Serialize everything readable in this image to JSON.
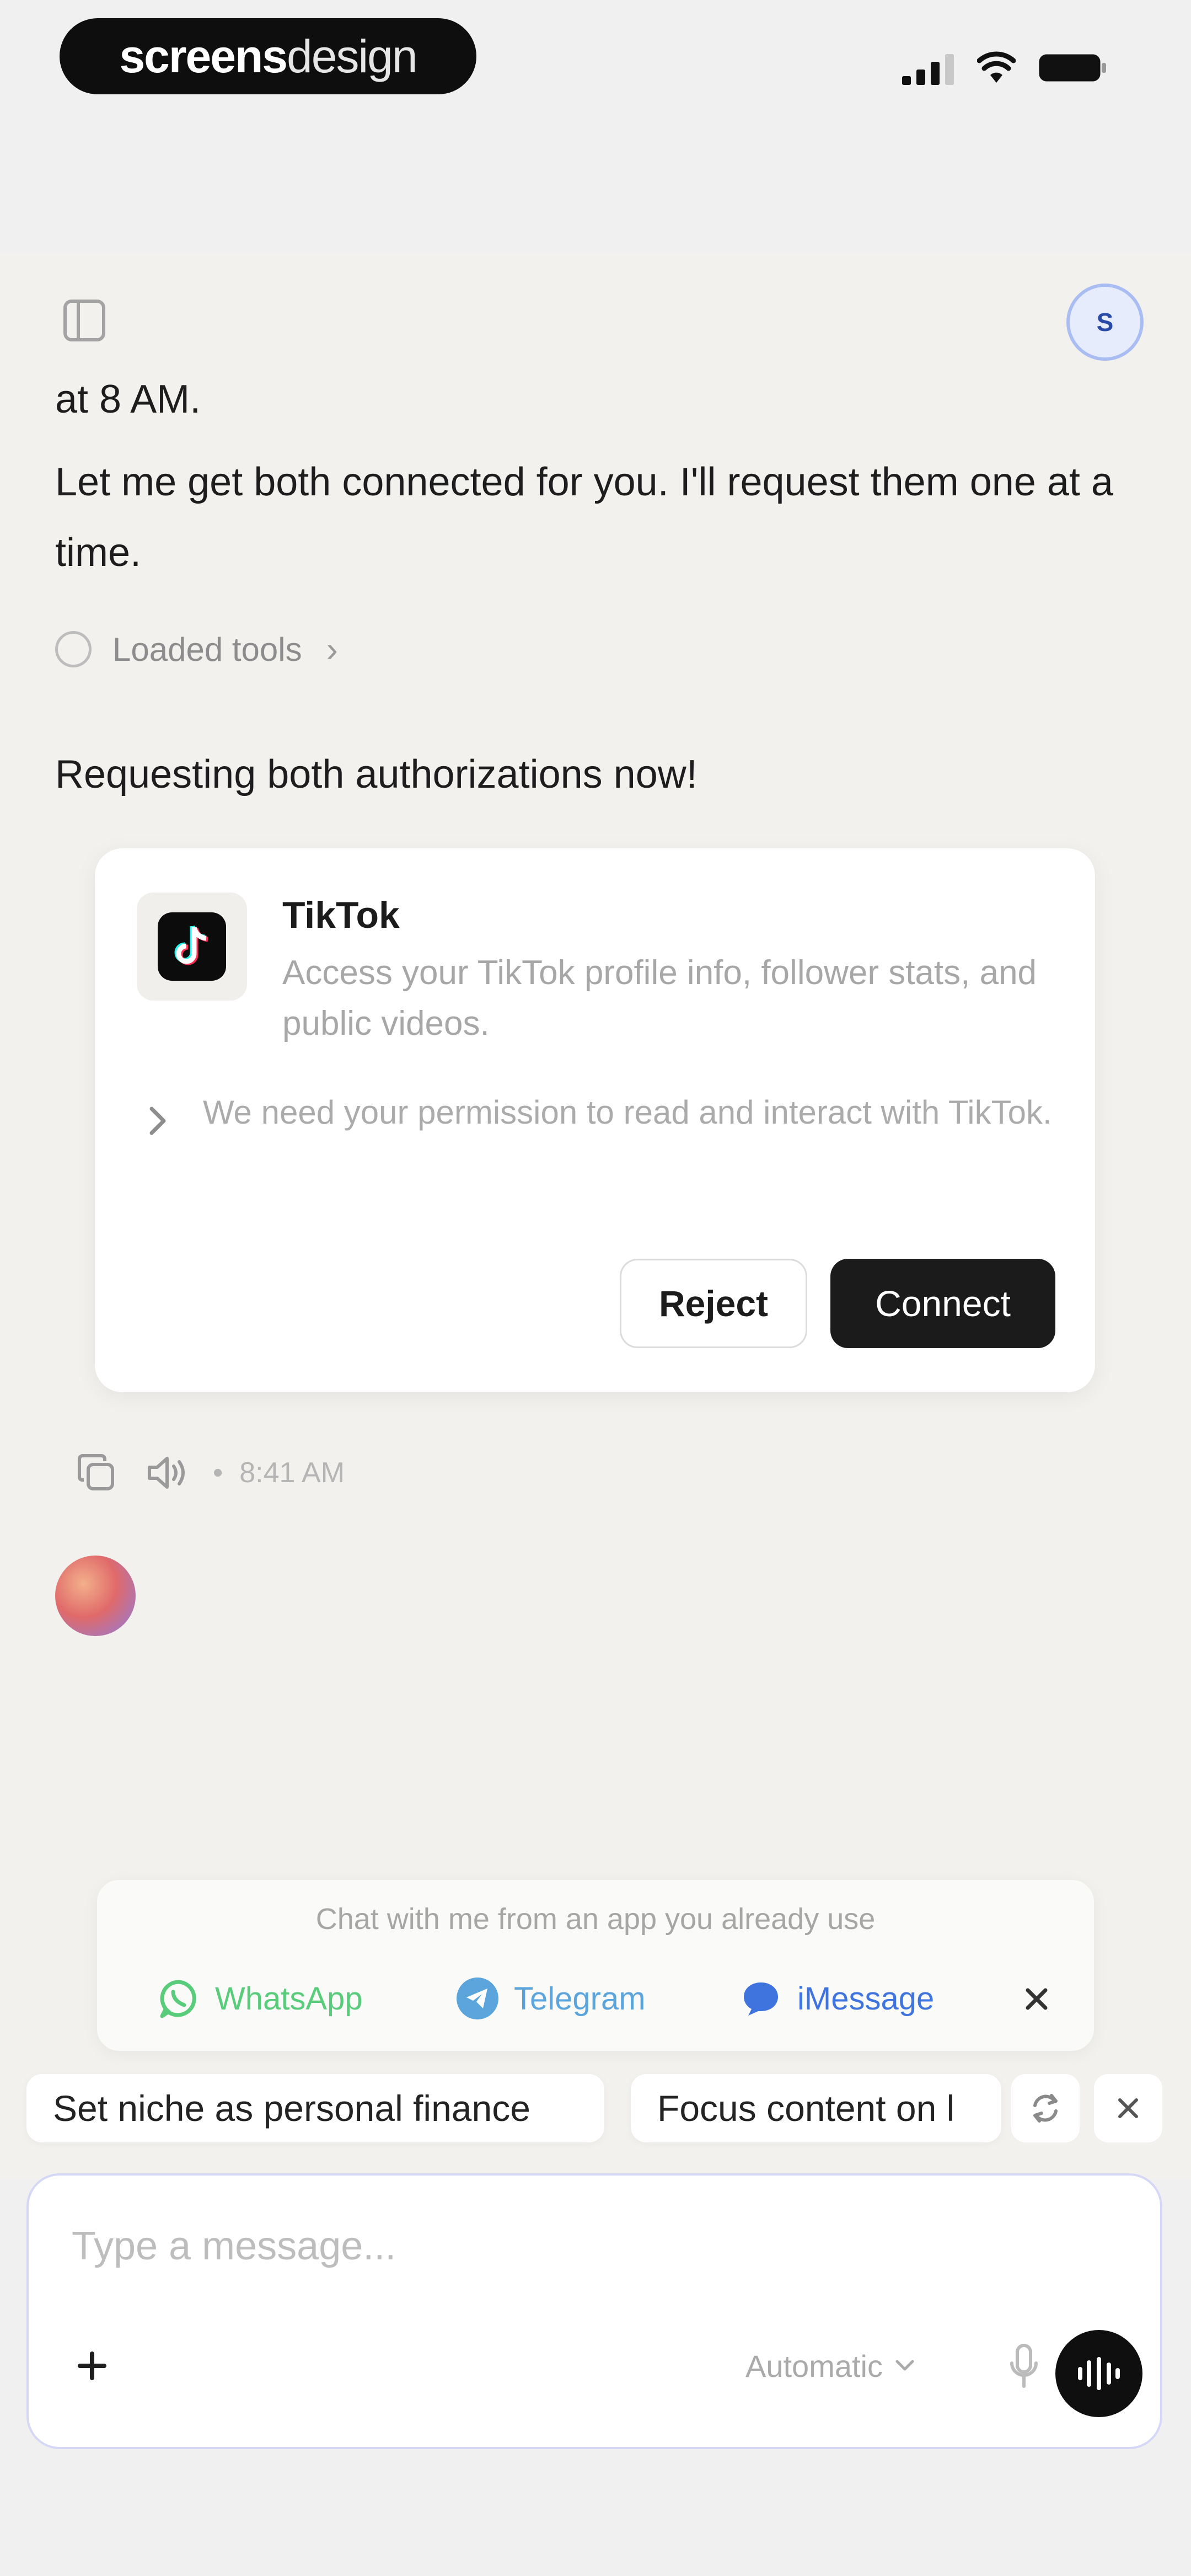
{
  "brand": {
    "part1": "screens",
    "part2": "design"
  },
  "chat": {
    "avatar_initial": "S",
    "line1": "at 8 AM.",
    "line2": "Let me get both connected for you. I'll request them one at a time.",
    "tools_label": "Loaded tools",
    "line3": "Requesting both authorizations now!"
  },
  "auth_card": {
    "title": "TikTok",
    "description": "Access your TikTok profile info, follower stats, and public videos.",
    "permission": "We need your permission to read and interact with TikTok.",
    "reject_label": "Reject",
    "connect_label": "Connect"
  },
  "message_meta": {
    "time": "8:41 AM"
  },
  "channels": {
    "prompt": "Chat with me from an app you already use",
    "items": [
      {
        "label": "WhatsApp",
        "icon": "whatsapp-icon",
        "color": "#58cc7a"
      },
      {
        "label": "Telegram",
        "icon": "telegram-icon",
        "color": "#5ba5dc"
      },
      {
        "label": "iMessage",
        "icon": "imessage-icon",
        "color": "#3f74df"
      }
    ]
  },
  "suggestions": [
    "Set niche as personal finance",
    "Focus content on l"
  ],
  "composer": {
    "placeholder": "Type a message...",
    "model": "Automatic"
  },
  "colors": {
    "accent_dark": "#1b1b1b",
    "composer_border": "#d4d8f6",
    "avatar_ring": "#a9bdf2"
  }
}
